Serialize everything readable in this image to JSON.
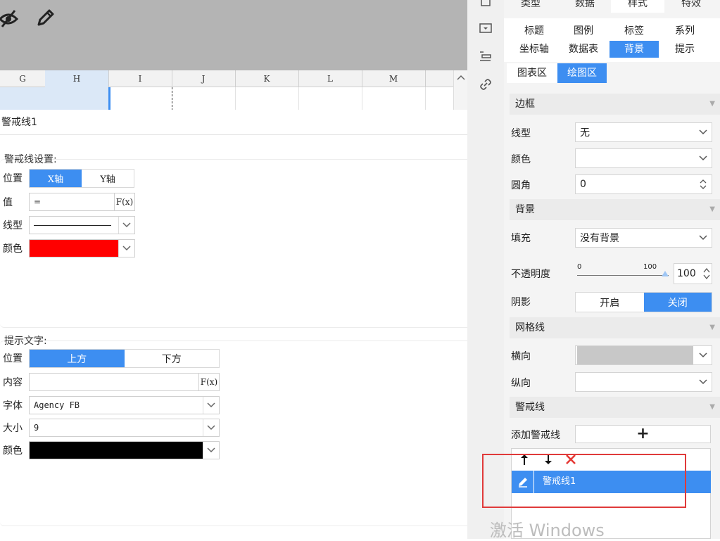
{
  "colors": {
    "accent": "#3d8ef1",
    "warning_line_color": "#ff0000",
    "tip_color": "#000000",
    "highlight_box": "#e03a3a"
  },
  "toolbar": {
    "icons": [
      "eye-slash-icon",
      "pencil-icon"
    ]
  },
  "sheet": {
    "columns": [
      "G",
      "H",
      "I",
      "J",
      "K",
      "L",
      "M"
    ],
    "selected_column": "H"
  },
  "dialog": {
    "title": "警戒线1",
    "line_settings": {
      "group_title": "警戒线设置:",
      "position_label": "位置",
      "position_options": [
        "X轴",
        "Y轴"
      ],
      "value_label": "值",
      "value_input": "=",
      "fx_label": "F(x)",
      "line_type_label": "线型",
      "color_label": "颜色"
    },
    "tip_text": {
      "group_title": "提示文字:",
      "position_label": "位置",
      "position_options": [
        "上方",
        "下方"
      ],
      "content_label": "内容",
      "content_value": "",
      "fx_label": "F(x)",
      "font_label": "字体",
      "font_value": "Agency FB",
      "size_label": "大小",
      "size_value": "9",
      "color_label": "颜色"
    }
  },
  "side_icons": [
    "square-icon",
    "dropdown-box-icon",
    "layout-list-icon",
    "link-icon"
  ],
  "panel": {
    "tabs": [
      "类型",
      "数据",
      "样式",
      "特效"
    ],
    "active_tab": "样式",
    "subtabs_row1": [
      "标题",
      "图例",
      "标签",
      "系列"
    ],
    "subtabs_row2": [
      "坐标轴",
      "数据表",
      "背景",
      "提示"
    ],
    "active_subtab": "背景",
    "area_tabs": [
      "图表区",
      "绘图区"
    ],
    "active_area_tab": "绘图区",
    "border": {
      "header": "边框",
      "line_type_label": "线型",
      "line_type_value": "无",
      "color_label": "颜色",
      "radius_label": "圆角",
      "radius_value": "0"
    },
    "background": {
      "header": "背景",
      "fill_label": "填充",
      "fill_value": "没有背景",
      "opacity_label": "不透明度",
      "opacity_min": "0",
      "opacity_max": "100",
      "opacity_value": "100",
      "shadow_label": "阴影",
      "shadow_options": [
        "开启",
        "关闭"
      ],
      "shadow_active": "关闭"
    },
    "gridlines": {
      "header": "网格线",
      "horizontal_label": "横向",
      "vertical_label": "纵向"
    },
    "warning_lines": {
      "header": "警戒线",
      "add_label": "添加警戒线",
      "add_symbol": "+",
      "items": [
        "警戒线1"
      ]
    }
  },
  "watermark": "激活 Windows"
}
